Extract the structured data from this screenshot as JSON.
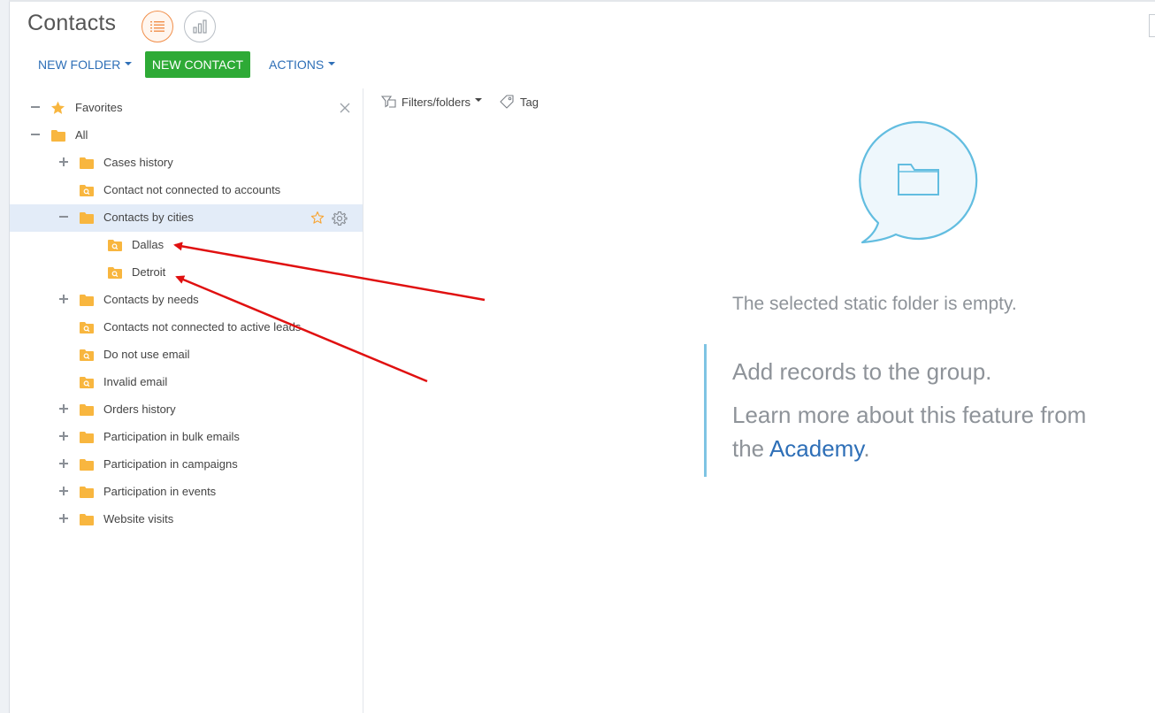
{
  "header": {
    "title": "Contacts",
    "view_list_icon": "list-icon",
    "view_chart_icon": "bar-chart-icon"
  },
  "toolbar": {
    "new_folder_label": "NEW FOLDER",
    "new_contact_label": "NEW CONTACT",
    "actions_label": "ACTIONS",
    "accent_color": "#2e6fb7",
    "new_contact_color": "#2eaa36"
  },
  "sidebar": {
    "favorites": {
      "label": "Favorites",
      "icon": "star-icon"
    },
    "all": {
      "label": "All",
      "icon": "folder-icon"
    },
    "items": [
      {
        "label": "Cases history",
        "toggle": "plus",
        "type": "folder"
      },
      {
        "label": "Contact not connected to accounts",
        "toggle": "none",
        "type": "search-folder"
      },
      {
        "label": "Contacts by cities",
        "toggle": "minus",
        "type": "folder",
        "selected": true
      },
      {
        "label": "Dallas",
        "toggle": "none",
        "type": "search-folder"
      },
      {
        "label": "Detroit",
        "toggle": "none",
        "type": "search-folder"
      },
      {
        "label": "Contacts by needs",
        "toggle": "plus",
        "type": "folder"
      },
      {
        "label": "Contacts not connected to active leads",
        "toggle": "none",
        "type": "search-folder"
      },
      {
        "label": "Do not use email",
        "toggle": "none",
        "type": "search-folder"
      },
      {
        "label": "Invalid email",
        "toggle": "none",
        "type": "search-folder"
      },
      {
        "label": "Orders history",
        "toggle": "plus",
        "type": "folder"
      },
      {
        "label": "Participation in bulk emails",
        "toggle": "plus",
        "type": "folder"
      },
      {
        "label": "Participation in campaigns",
        "toggle": "plus",
        "type": "folder"
      },
      {
        "label": "Participation in events",
        "toggle": "plus",
        "type": "folder"
      },
      {
        "label": "Website visits",
        "toggle": "plus",
        "type": "folder"
      }
    ],
    "folder_color": "#f8b63f",
    "selected_color": "#e3ecf8"
  },
  "filters": {
    "filters_label": "Filters/folders",
    "tag_label": "Tag"
  },
  "empty_state": {
    "message": "The selected static folder is empty.",
    "hint_line1": "Add records to the group.",
    "hint_line2": "Learn more about this feature from",
    "hint_line3_prefix": "the ",
    "academy_link": "Academy",
    "hint_line3_suffix": "."
  },
  "annotations": {
    "arrow_color": "#e01010"
  }
}
